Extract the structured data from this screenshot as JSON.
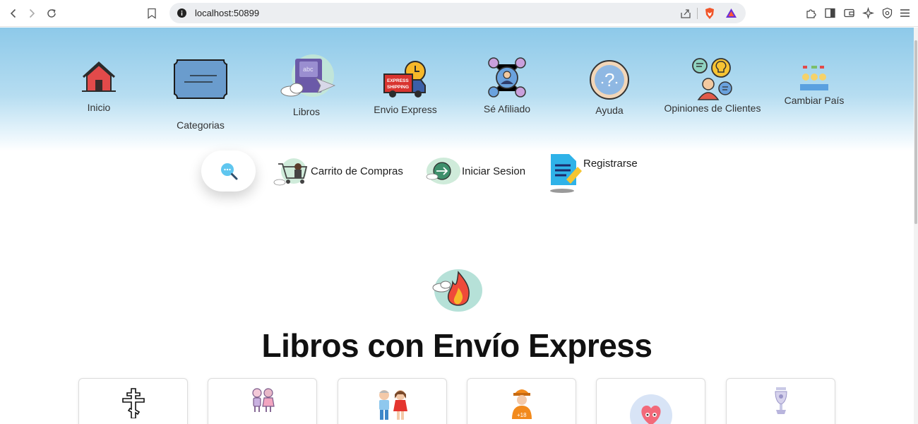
{
  "browser": {
    "url": "localhost:50899",
    "icons": [
      "back-icon",
      "forward-icon",
      "reload-icon",
      "bookmark-icon",
      "info-icon",
      "share-icon",
      "brave-shield-icon",
      "brave-rewards-icon",
      "extensions-icon",
      "sidebar-icon",
      "wallet-icon",
      "leo-ai-icon",
      "vpn-icon",
      "menu-icon"
    ]
  },
  "nav": {
    "items": [
      {
        "label": "Inicio",
        "icon": "home-icon"
      },
      {
        "label": "Categorias",
        "icon": "categories-icon"
      },
      {
        "label": "Libros",
        "icon": "books-icon"
      },
      {
        "label": "Envio Express",
        "icon": "express-truck-icon"
      },
      {
        "label": "Sé Afiliado",
        "icon": "affiliate-network-icon"
      },
      {
        "label": "Ayuda",
        "icon": "help-icon"
      },
      {
        "label": "Opiniones de Clientes",
        "icon": "customer-opinions-icon"
      },
      {
        "label": "Cambiar País",
        "icon": "change-country-icon"
      }
    ]
  },
  "actions": {
    "search_icon": "search-icon",
    "cart_label": "Carrito de Compras",
    "login_label": "Iniciar Sesion",
    "register_label": "Registrarse"
  },
  "main": {
    "section_icon": "fire-icon",
    "section_title": "Libros con Envío Express",
    "cards": [
      {
        "icon": "orthodox-cross-icon"
      },
      {
        "icon": "kids-couple-icon"
      },
      {
        "icon": "boy-girl-icon"
      },
      {
        "icon": "adult-18-icon"
      },
      {
        "icon": "heart-face-icon"
      },
      {
        "icon": "trophy-vase-icon"
      }
    ]
  },
  "colors": {
    "header_top": "#8dc9e9",
    "header_bottom": "#ffffff",
    "title": "#111111"
  }
}
